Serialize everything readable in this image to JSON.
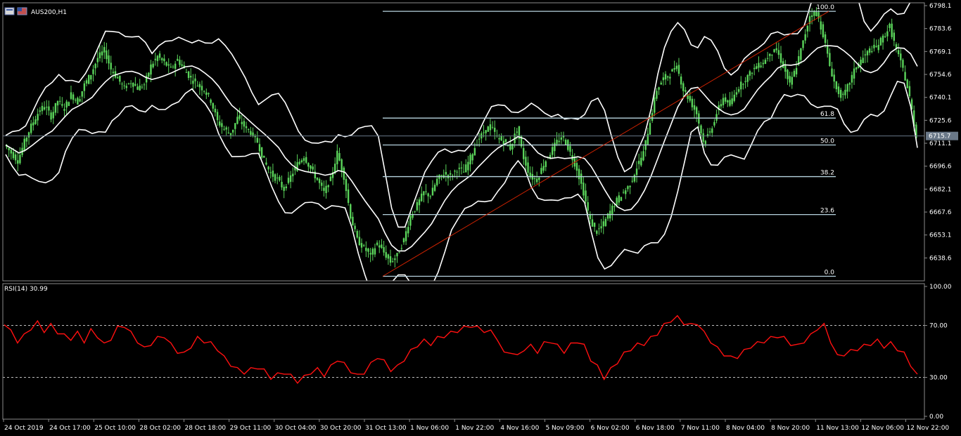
{
  "window": {
    "symbol_label": "AUS200,H1",
    "indicator_label": "RSI(14) 30.99",
    "current_price_label": "6715.7"
  },
  "colors": {
    "background": "#000000",
    "candle": "#5ad45a",
    "bands": "#ffffff",
    "fib": "#b8d4e0",
    "trend": "#cc2200",
    "rsi": "#ff1010",
    "frame": "#8a8a8a"
  },
  "chart_data": [
    {
      "type": "candlestick",
      "title": "AUS200,H1",
      "yticks": [
        "6798.1",
        "6783.6",
        "6769.1",
        "6754.6",
        "6740.1",
        "6725.6",
        "6711.1",
        "6696.6",
        "6682.1",
        "6667.6",
        "6653.1",
        "6638.6"
      ],
      "ylim": [
        6625,
        6799
      ],
      "last_price": 6715.7,
      "xticks": [
        "24 Oct 2019",
        "24 Oct 17:00",
        "25 Oct 10:00",
        "28 Oct 02:00",
        "28 Oct 18:00",
        "29 Oct 11:00",
        "30 Oct 04:00",
        "30 Oct 20:00",
        "31 Oct 13:00",
        "1 Nov 06:00",
        "1 Nov 22:00",
        "4 Nov 16:00",
        "5 Nov 09:00",
        "6 Nov 02:00",
        "6 Nov 18:00",
        "7 Nov 11:00",
        "8 Nov 04:00",
        "8 Nov 20:00",
        "11 Nov 13:00",
        "12 Nov 06:00",
        "12 Nov 22:00"
      ],
      "close_path": [
        6710,
        6705,
        6700,
        6712,
        6722,
        6730,
        6735,
        6728,
        6738,
        6733,
        6742,
        6737,
        6748,
        6755,
        6765,
        6770,
        6758,
        6752,
        6746,
        6750,
        6746,
        6748,
        6760,
        6766,
        6762,
        6758,
        6764,
        6758,
        6752,
        6748,
        6745,
        6738,
        6725,
        6720,
        6717,
        6727,
        6722,
        6718,
        6712,
        6700,
        6692,
        6688,
        6682,
        6690,
        6698,
        6703,
        6695,
        6688,
        6680,
        6688,
        6705,
        6690,
        6665,
        6650,
        6645,
        6640,
        6648,
        6642,
        6636,
        6640,
        6650,
        6665,
        6672,
        6680,
        6678,
        6688,
        6692,
        6690,
        6695,
        6693,
        6702,
        6712,
        6718,
        6722,
        6715,
        6712,
        6708,
        6720,
        6702,
        6690,
        6688,
        6698,
        6705,
        6712,
        6715,
        6705,
        6695,
        6680,
        6662,
        6655,
        6660,
        6668,
        6675,
        6680,
        6685,
        6696,
        6705,
        6725,
        6745,
        6752,
        6755,
        6760,
        6745,
        6738,
        6730,
        6712,
        6718,
        6730,
        6740,
        6735,
        6745,
        6750,
        6755,
        6760,
        6762,
        6768,
        6770,
        6760,
        6748,
        6760,
        6775,
        6792,
        6794,
        6780,
        6760,
        6745,
        6740,
        6750,
        6760,
        6765,
        6770,
        6772,
        6778,
        6785,
        6770,
        6758,
        6740,
        6715
      ],
      "fib_levels": [
        {
          "label": "100.0",
          "price": 6794.5
        },
        {
          "label": "61.8",
          "price": 6727.0
        },
        {
          "label": "50.0",
          "price": 6710.0
        },
        {
          "label": "38.2",
          "price": 6690.0
        },
        {
          "label": "23.6",
          "price": 6666.0
        },
        {
          "label": "0.0",
          "price": 6627.0
        }
      ]
    },
    {
      "type": "line",
      "title": "RSI(14) 30.99",
      "yticks": [
        "100.00",
        "70.00",
        "30.00",
        "0.00"
      ],
      "ylim": [
        0,
        100
      ],
      "levels": [
        70,
        30
      ],
      "values": [
        72,
        65,
        58,
        62,
        68,
        72,
        66,
        70,
        65,
        62,
        60,
        64,
        58,
        66,
        62,
        55,
        60,
        68,
        70,
        64,
        58,
        52,
        56,
        60,
        62,
        55,
        50,
        48,
        54,
        60,
        58,
        56,
        52,
        45,
        40,
        36,
        34,
        36,
        38,
        35,
        30,
        32,
        34,
        31,
        27,
        30,
        34,
        36,
        32,
        38,
        44,
        40,
        35,
        31,
        34,
        40,
        46,
        42,
        36,
        38,
        44,
        50,
        55,
        58,
        56,
        60,
        62,
        64,
        66,
        68,
        70,
        68,
        66,
        65,
        60,
        48,
        50,
        46,
        52,
        54,
        50,
        56,
        58,
        54,
        50,
        55,
        58,
        54,
        44,
        38,
        30,
        36,
        42,
        48,
        52,
        55,
        56,
        60,
        64,
        70,
        74,
        76,
        72,
        70,
        72,
        64,
        58,
        52,
        48,
        45,
        46,
        50,
        54,
        56,
        58,
        60,
        62,
        60,
        56,
        54,
        58,
        62,
        68,
        70,
        58,
        46,
        48,
        50,
        52,
        54,
        56,
        58,
        54,
        56,
        52,
        48,
        40,
        31
      ]
    }
  ]
}
